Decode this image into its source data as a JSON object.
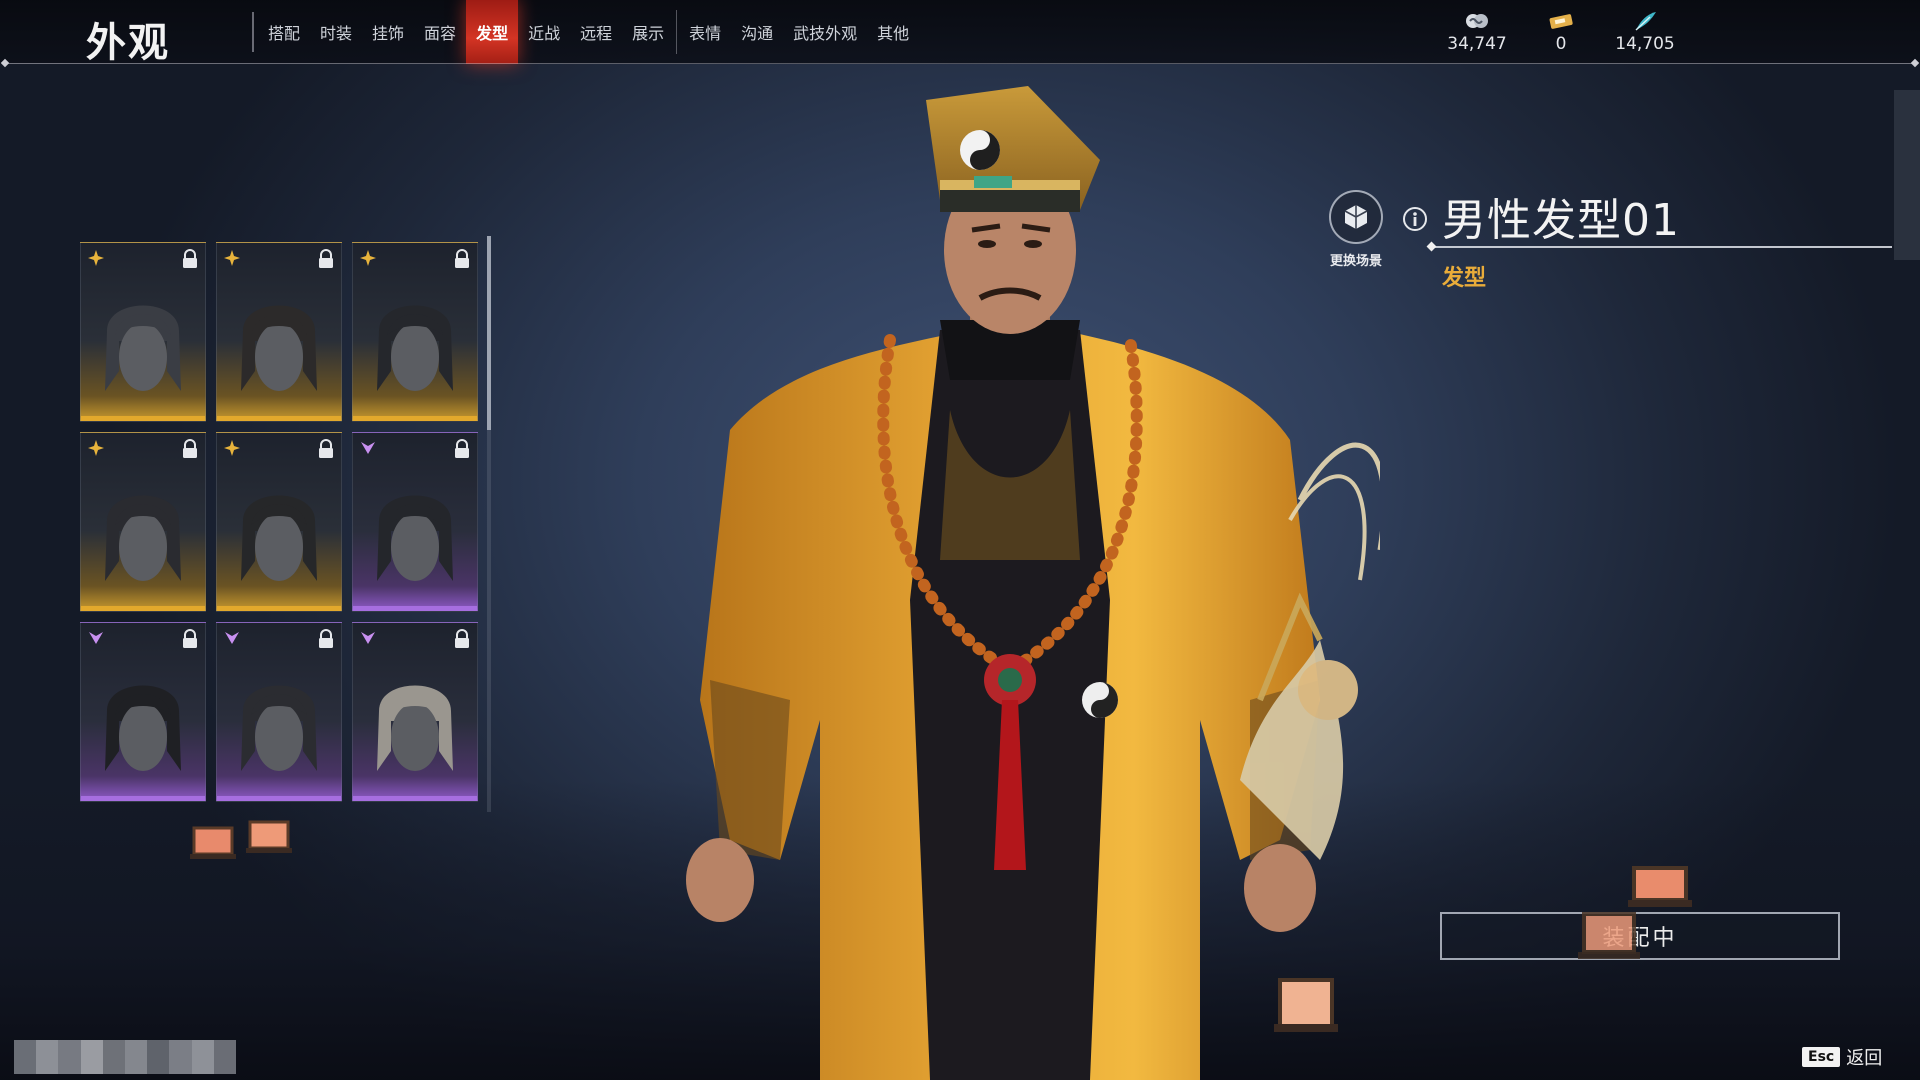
{
  "header": {
    "title": "外观",
    "tabs": [
      {
        "label": "搭配",
        "active": false
      },
      {
        "label": "时装",
        "active": false
      },
      {
        "label": "挂饰",
        "active": false
      },
      {
        "label": "面容",
        "active": false
      },
      {
        "label": "发型",
        "active": true
      },
      {
        "label": "近战",
        "active": false
      },
      {
        "label": "远程",
        "active": false
      },
      {
        "label": "展示",
        "active": false
      },
      {
        "label": "表情",
        "active": false
      },
      {
        "label": "沟通",
        "active": false
      },
      {
        "label": "武技外观",
        "active": false
      },
      {
        "label": "其他",
        "active": false
      }
    ],
    "currencies": [
      {
        "icon": "cloud-coin-icon",
        "value": "34,747"
      },
      {
        "icon": "ticket-icon",
        "value": "0"
      },
      {
        "icon": "feather-icon",
        "value": "14,705"
      }
    ]
  },
  "hair_grid": {
    "items": [
      {
        "rarity": "gold",
        "locked": true
      },
      {
        "rarity": "gold",
        "locked": true
      },
      {
        "rarity": "gold",
        "locked": true
      },
      {
        "rarity": "gold",
        "locked": true
      },
      {
        "rarity": "gold",
        "locked": true
      },
      {
        "rarity": "purple",
        "locked": true
      },
      {
        "rarity": "purple",
        "locked": true
      },
      {
        "rarity": "purple",
        "locked": true
      },
      {
        "rarity": "purple",
        "locked": true
      }
    ]
  },
  "detail": {
    "scene_label": "更换场景",
    "item_name": "男性发型01",
    "item_type": "发型",
    "equip_label": "装配中"
  },
  "footer": {
    "esc_key": "Esc",
    "back_label": "返回"
  },
  "colors": {
    "active_tab": "#d43424",
    "gold": "#e3a92c",
    "purple": "#a66ee0",
    "item_type": "#e9ac3a"
  }
}
